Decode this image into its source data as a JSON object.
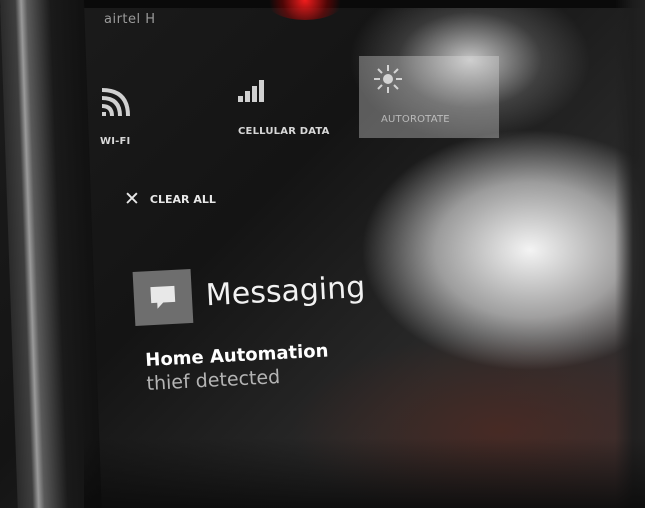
{
  "status_bar": {
    "carrier": "airtel H"
  },
  "quick_actions": [
    {
      "label": "WI-FI",
      "icon": "wifi-icon"
    },
    {
      "label": "CELLULAR DATA",
      "icon": "cellular-signal-icon"
    },
    {
      "label": "AUTOROTATE",
      "icon": "brightness-icon"
    }
  ],
  "action_center": {
    "clear_all_label": "CLEAR ALL"
  },
  "notification": {
    "app_name": "Messaging",
    "app_icon": "message-bubble-icon",
    "title": "Home Automation",
    "body": "thief detected"
  }
}
